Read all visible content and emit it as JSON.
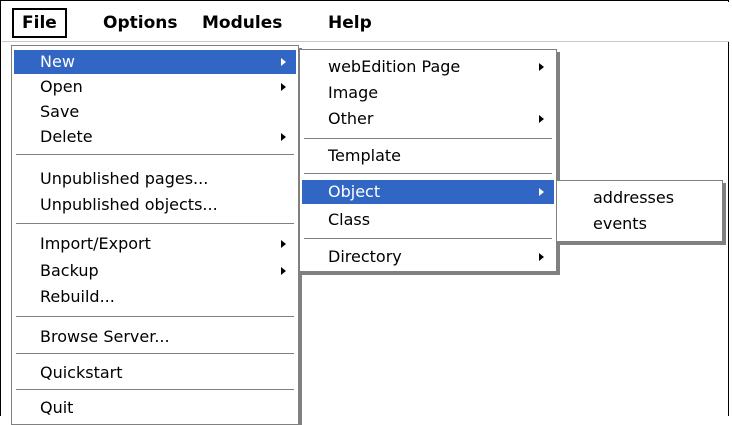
{
  "menubar": {
    "file": "File",
    "options": "Options",
    "modules": "Modules",
    "help": "Help"
  },
  "file_menu": {
    "new": "New",
    "open": "Open",
    "save": "Save",
    "delete": "Delete",
    "unpublished_pages": "Unpublished pages...",
    "unpublished_objects": "Unpublished objects...",
    "import_export": "Import/Export",
    "backup": "Backup",
    "rebuild": "Rebuild...",
    "browse_server": "Browse Server...",
    "quickstart": "Quickstart",
    "quit": "Quit"
  },
  "new_menu": {
    "webedition_page": "webEdition Page",
    "image": "Image",
    "other": "Other",
    "template": "Template",
    "object": "Object",
    "class": "Class",
    "directory": "Directory"
  },
  "object_menu": {
    "addresses": "addresses",
    "events": "events"
  },
  "colors": {
    "highlight": "#3166c4"
  }
}
